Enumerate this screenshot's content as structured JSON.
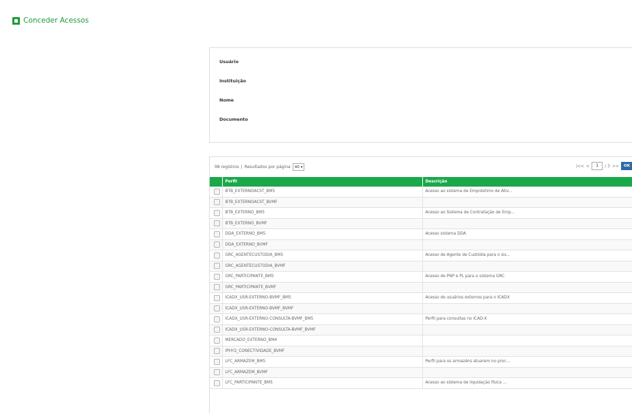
{
  "header": {
    "title": "Conceder Acessos",
    "icon": "grant-access-icon",
    "accent_color": "#1f9b3e"
  },
  "user_panel": {
    "fields": [
      "Usuário",
      "Instituição",
      "Nome",
      "Documento"
    ]
  },
  "results": {
    "records_text": "98 registros",
    "separator": "|",
    "per_page_label": "Resultados por página",
    "per_page_value": "40",
    "pager": {
      "first_label": "|<<",
      "prev_label": "<",
      "current_page": "1",
      "total_pages": "/ 3",
      "next_label": ">>",
      "ok_label": "OK"
    }
  },
  "table": {
    "header_color": "#1aa84a",
    "columns": [
      "Perfil",
      "Descrição"
    ],
    "rows": [
      {
        "perfil": "BTB_EXTERNOACST_BM5",
        "descricao": "Acesso ao sistema de Empréstimo de Ativ..."
      },
      {
        "perfil": "BTB_EXTERNOACST_BVMF",
        "descricao": ""
      },
      {
        "perfil": "BTB_EXTERNO_BM5",
        "descricao": "Acesso ao Sistema de Contratação de Emp..."
      },
      {
        "perfil": "BTB_EXTERNO_BVMF",
        "descricao": ""
      },
      {
        "perfil": "DDA_EXTERNO_BM5",
        "descricao": "Acesso sistema DDA"
      },
      {
        "perfil": "DDA_EXTERNO_BVMF",
        "descricao": ""
      },
      {
        "perfil": "GRC_AGENTECUSTODIA_BM5",
        "descricao": "Acesso de Agente de Custódia para o sis..."
      },
      {
        "perfil": "GRC_AGENTECUSTODIA_BVMF",
        "descricao": ""
      },
      {
        "perfil": "GRC_PARTICIPANTE_BM5",
        "descricao": "Acesso de PNP e PL para o sistema GRC"
      },
      {
        "perfil": "GRC_PARTICIPANTE_BVMF",
        "descricao": ""
      },
      {
        "perfil": "ICADX_USR-EXTERNO-BVMF_BM5",
        "descricao": "Acesso de usuários externos para o ICADX"
      },
      {
        "perfil": "ICADX_USR-EXTERNO-BVMF_BVMF",
        "descricao": ""
      },
      {
        "perfil": "ICADX_USR-EXTERNO-CONSULTA-BVMF_BM5",
        "descricao": "Perfil para consultas no ICAD-X"
      },
      {
        "perfil": "ICADX_USR-EXTERNO-CONSULTA-BVMF_BVMF",
        "descricao": ""
      },
      {
        "perfil": "MERCADO_EXTERNO_BM4",
        "descricao": ""
      },
      {
        "perfil": "IPHY2_CONECTIVIDADE_BVMF",
        "descricao": ""
      },
      {
        "perfil": "LFC_ARMAZEM_BM5",
        "descricao": "Perfil para os armazéns atuarem no proc..."
      },
      {
        "perfil": "LFC_ARMAZEM_BVMF",
        "descricao": ""
      },
      {
        "perfil": "LFC_PARTICIPANTE_BM5",
        "descricao": "Acesso ao sistema de liquidação física ..."
      }
    ]
  }
}
